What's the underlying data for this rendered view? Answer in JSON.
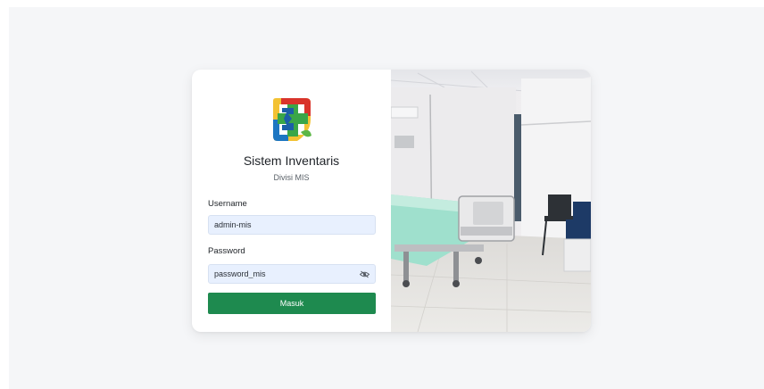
{
  "app": {
    "title": "Sistem Inventaris",
    "subtitle": "Divisi MIS"
  },
  "form": {
    "username_label": "Username",
    "username_value": "admin-mis",
    "password_label": "Password",
    "password_value": "password_mis",
    "submit_label": "Masuk",
    "toggle_icon": "eye-slash-icon"
  },
  "colors": {
    "accent": "#1e8a4f",
    "input_bg": "#e8f0fe",
    "page_bg": "#f5f6f8"
  }
}
